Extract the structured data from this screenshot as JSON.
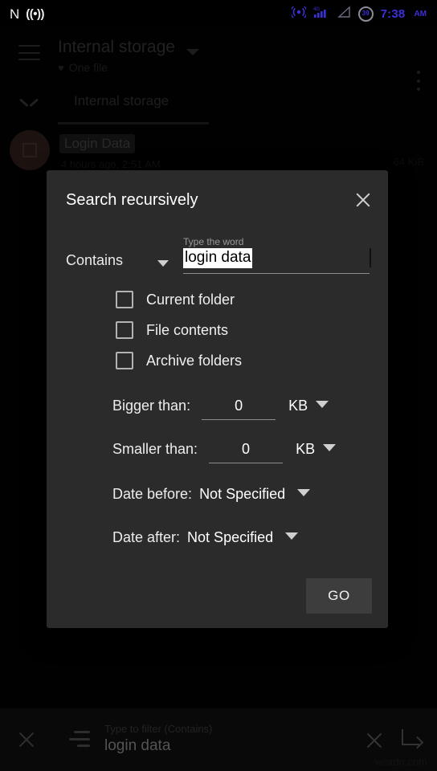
{
  "status_bar": {
    "nfc_label": "N",
    "tether_icon": "((•))",
    "hotspot_icon": "cast-icon",
    "network_label": "4G",
    "battery_level": "39",
    "time": "7:38",
    "meridiem": "AM",
    "accent_color": "#3b2fd8"
  },
  "app_bar": {
    "menu_icon": "hamburger-icon",
    "title": "Internal storage",
    "subtitle": "One file",
    "favorite_icon": "♥",
    "overflow_icon": "more-vertical-icon"
  },
  "breadcrumb": {
    "expand_icon": "chevron-down-icon",
    "tab_label": "Internal storage"
  },
  "file_row": {
    "name": "Login Data",
    "modified": "4 hours ago, 2:51 AM",
    "size": "64 KiB",
    "avatar_icon": "file-square-icon"
  },
  "dialog": {
    "title": "Search recursively",
    "close_icon": "close-icon",
    "query": {
      "mode_label": "Contains",
      "mode_caret": "chevron-down-icon",
      "float_label": "Type the word",
      "value": "login data",
      "selected": true
    },
    "checkboxes": [
      {
        "label": "Current folder",
        "checked": false
      },
      {
        "label": "File contents",
        "checked": false
      },
      {
        "label": "Archive folders",
        "checked": false
      }
    ],
    "size_filters": [
      {
        "label": "Bigger than:",
        "value": "0",
        "unit": "KB"
      },
      {
        "label": "Smaller than:",
        "value": "0",
        "unit": "KB"
      }
    ],
    "date_filters": [
      {
        "label": "Date before:",
        "value": "Not Specified"
      },
      {
        "label": "Date after:",
        "value": "Not Specified"
      }
    ],
    "submit_label": "GO"
  },
  "bottom_bar": {
    "close_icon": "close-icon",
    "filter_icon": "filter-lines-icon",
    "hint": "Type to filter (Contains)",
    "value": "login data",
    "clear_icon": "close-icon",
    "submit_icon": "enter-arrow-icon"
  },
  "watermark": "wsxdn.com"
}
